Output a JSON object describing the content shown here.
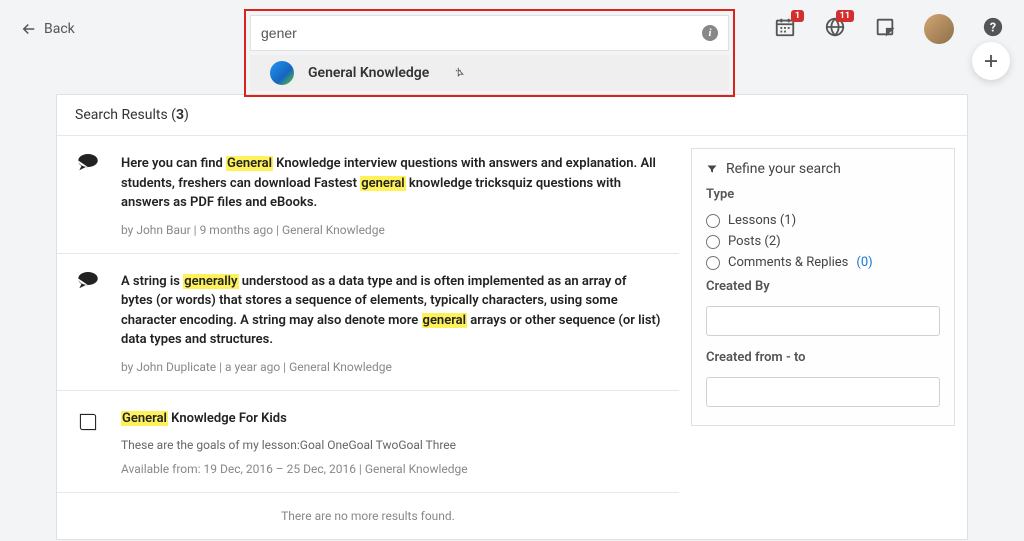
{
  "header": {
    "back": "Back",
    "search_value": "gener",
    "suggestion": "General Knowledge",
    "badge_cal": "1",
    "badge_globe": "11"
  },
  "results": {
    "title_prefix": "Search Results (",
    "count": "3",
    "title_suffix": ")",
    "no_more": "There are no more results found.",
    "items": [
      {
        "pre1": "Here you can find ",
        "hl1": "General",
        "mid1": " Knowledge interview questions with answers and explanation. All students, freshers can download Fastest ",
        "hl2": "general",
        "post1": " knowledge tricksquiz questions with answers as PDF files and eBooks.",
        "meta": "by John Baur | 9 months ago | General Knowledge",
        "icon": "chat"
      },
      {
        "pre1": "A string is ",
        "hl1": "generally",
        "mid1": " understood as a data type and is often implemented as an array of bytes (or words) that stores a sequence of elements, typically characters, using some character encoding. A string may also denote more ",
        "hl2": "general",
        "post1": " arrays or other sequence (or list) data types and structures.",
        "meta": "by John Duplicate | a year ago | General Knowledge",
        "icon": "chat"
      },
      {
        "pre1": "",
        "hl1": "General",
        "mid1": " Knowledge For Kids",
        "hl2": "",
        "post1": "",
        "goals": "These are the goals of my lesson:Goal OneGoal TwoGoal Three",
        "meta": "Available from: 19 Dec, 2016 – 25 Dec, 2016 | General Knowledge",
        "icon": "book"
      }
    ]
  },
  "refine": {
    "title": "Refine your search",
    "type_label": "Type",
    "opts": [
      {
        "label": "Lessons (1)"
      },
      {
        "label": "Posts (2)"
      },
      {
        "label_pre": "Comments & Replies ",
        "count": "(0)"
      }
    ],
    "created_by": "Created By",
    "created_from": "Created from - to"
  }
}
